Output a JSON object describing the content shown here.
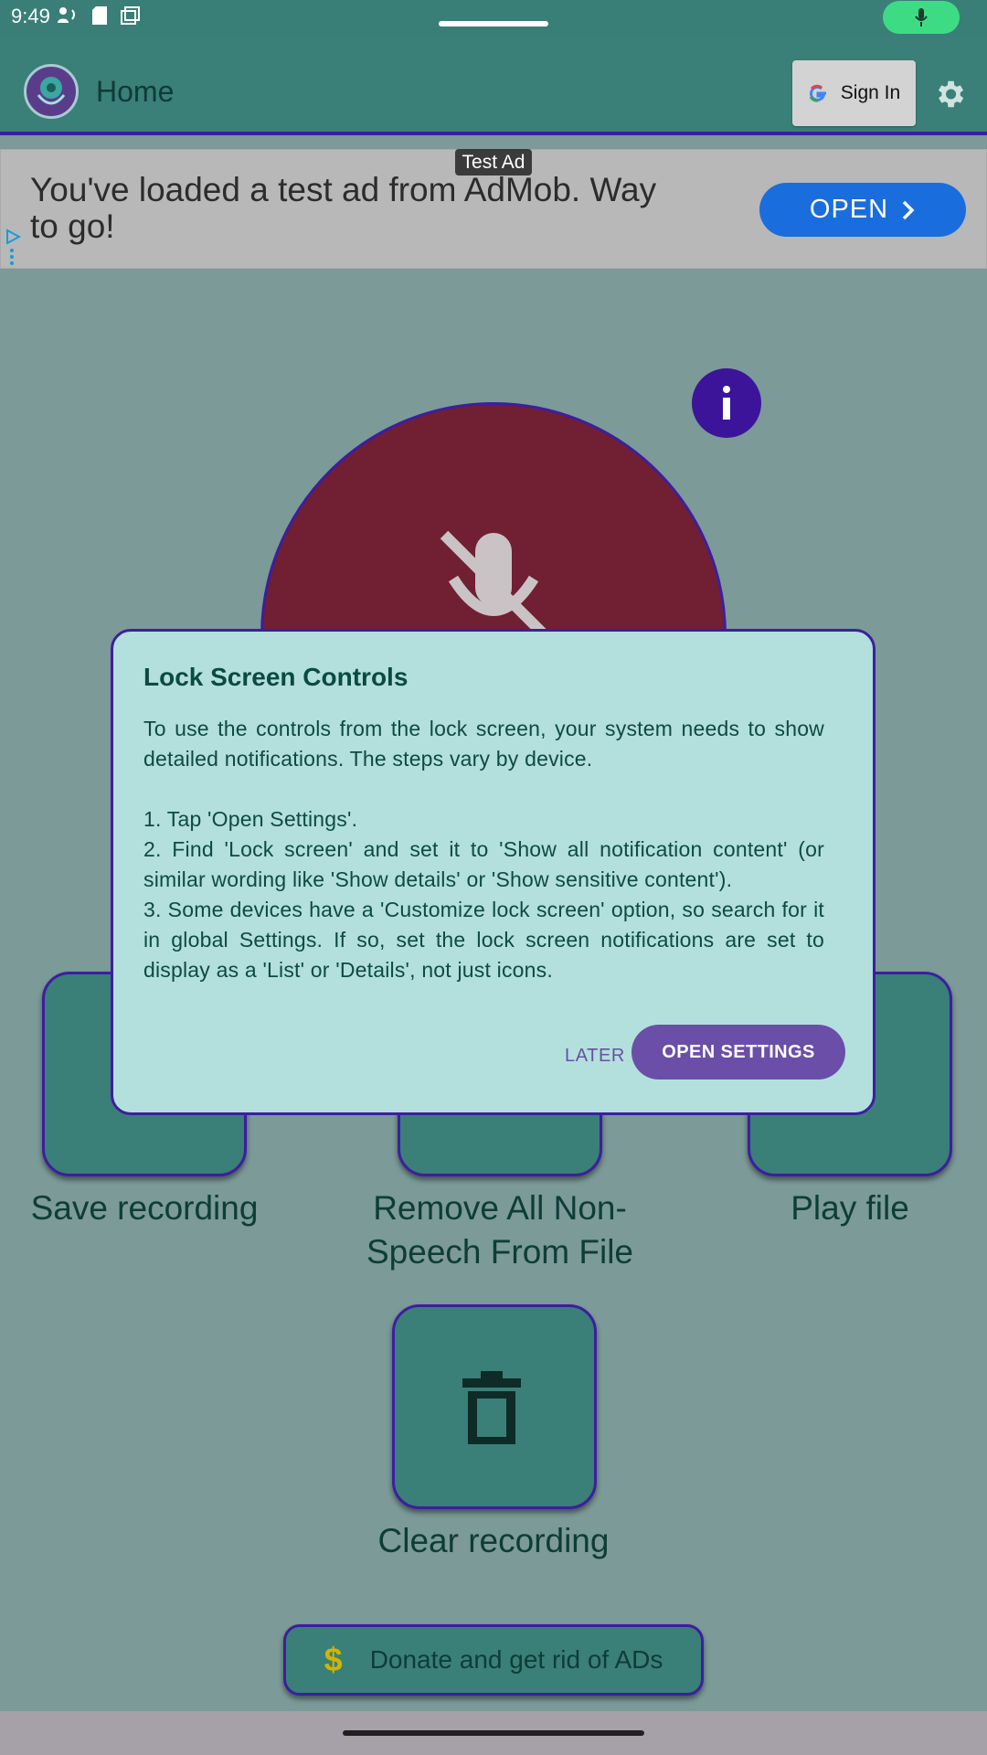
{
  "status_bar": {
    "time": "9:49"
  },
  "app_bar": {
    "title": "Home",
    "signin_label": "Sign In"
  },
  "ad": {
    "badge": "Test Ad",
    "text": "You've loaded a test ad from AdMob. Way to go!",
    "open_label": "OPEN"
  },
  "main": {
    "tiles": [
      {
        "label": "Save recording"
      },
      {
        "label": "Remove All Non-Speech From File"
      },
      {
        "label": "Play file"
      },
      {
        "label": "Clear recording"
      }
    ],
    "donate_label": "Donate and get rid of ADs",
    "donate_symbol": "$"
  },
  "dialog": {
    "title": "Lock Screen Controls",
    "body": "To use the controls from the lock screen, your system needs to show detailed notifications. The steps vary by device.\n\n1. Tap 'Open Settings'.\n2. Find 'Lock screen' and set it to 'Show all notification content' (or similar wording like 'Show details' or 'Show sensitive content').\n3. Some devices have a 'Customize lock screen' option, so search for it in global Settings. If so, set the lock screen notifications are set to display as a 'List' or 'Details', not just icons.",
    "later_label": "LATER",
    "open_settings_label": "OPEN SETTINGS"
  },
  "colors": {
    "header": "#3a7f78",
    "background": "#7b9a98",
    "record": "#711f33",
    "accent": "#3d1ea0",
    "dialog_bg": "#b3e0dc",
    "primary_button": "#6a4ea8"
  }
}
